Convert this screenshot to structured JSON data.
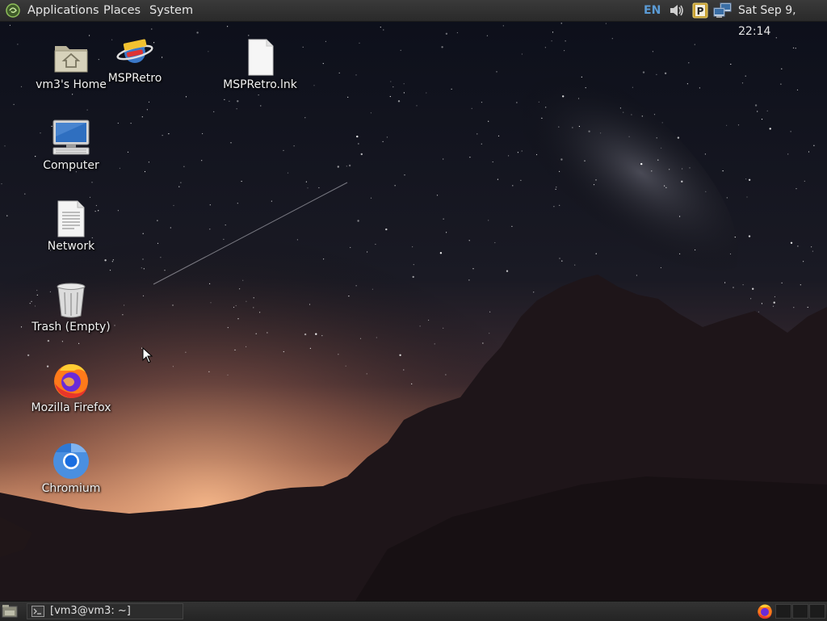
{
  "top_panel": {
    "menus": [
      {
        "label": "Applications"
      },
      {
        "label": "Places"
      },
      {
        "label": "System"
      }
    ],
    "tray": {
      "keyboard_layout": "EN",
      "icons": [
        "volume-icon",
        "clipboard-p-icon",
        "network-icon"
      ],
      "clock": "Sat Sep  9, 22:14"
    }
  },
  "desktop": {
    "icons": [
      {
        "label": "vm3's Home",
        "icon": "home-folder-icon"
      },
      {
        "label": "MSPRetro",
        "icon": "msp-planet-icon"
      },
      {
        "label": "MSPRetro.lnk",
        "icon": "blank-file-icon"
      },
      {
        "label": "Computer",
        "icon": "computer-icon"
      },
      {
        "label": "Network",
        "icon": "document-icon"
      },
      {
        "label": "Trash (Empty)",
        "icon": "trash-icon"
      },
      {
        "label": "Mozilla Firefox",
        "icon": "firefox-icon"
      },
      {
        "label": "Chromium",
        "icon": "chromium-icon"
      }
    ]
  },
  "bottom_panel": {
    "tasks": [
      {
        "label": "[vm3@vm3: ~]",
        "icon": "terminal-icon"
      }
    ],
    "tray_icons": [
      "firefox-icon"
    ]
  },
  "colors": {
    "panel_bg": "#2e2e2e",
    "panel_text": "#e6e6e6",
    "keyboard_accent": "#5b9bd5"
  }
}
